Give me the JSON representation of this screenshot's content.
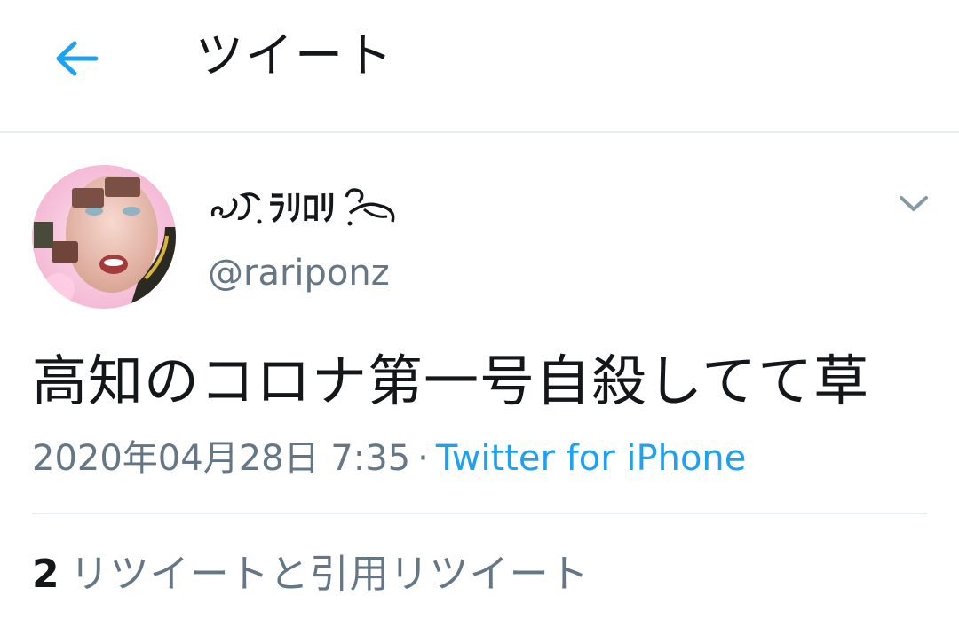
{
  "header": {
    "title": "ツイート",
    "back_icon": "arrow-left-icon"
  },
  "colors": {
    "accent": "#1da1f2",
    "text_primary": "#14171a",
    "text_secondary": "#657786",
    "divider": "#e6ecf0"
  },
  "tweet": {
    "author": {
      "display_name": "ﾗﾘﾛﾘ",
      "username": "@rariponz"
    },
    "text": "高知のコロナ第一号自殺してて草",
    "timestamp": "2020年04月28日 7:35",
    "separator": "·",
    "source": "Twitter for iPhone",
    "stats": {
      "retweet_count": "2",
      "retweet_label": "リツイートと引用リツイート"
    }
  }
}
